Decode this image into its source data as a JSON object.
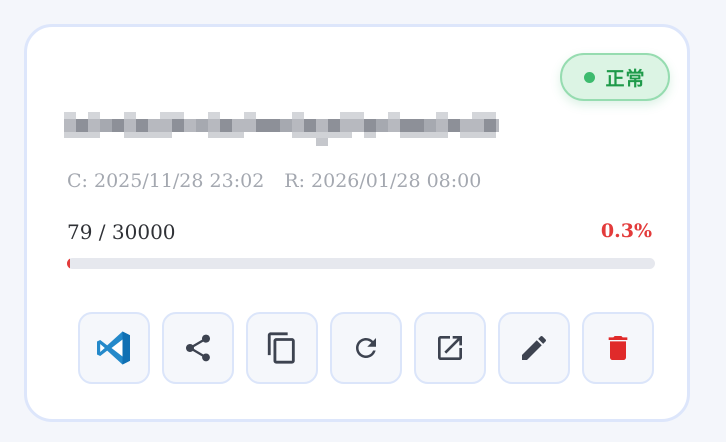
{
  "status": {
    "label": "正常",
    "color": "#1f9a4a",
    "dot_color": "#3dbb6e"
  },
  "item": {
    "name_redacted": true,
    "created": "C: 2025/11/28 23:02",
    "renews": "R: 2026/01/28 08:00"
  },
  "usage": {
    "text": "79 / 30000",
    "used": 79,
    "total": 30000,
    "percent_label": "0.3%",
    "percent": 0.3,
    "fill_color": "#e33b3b"
  },
  "actions": [
    {
      "name": "vscode-button",
      "icon": "vscode-icon",
      "color": "#1a8ad8"
    },
    {
      "name": "share-button",
      "icon": "share-icon",
      "color": "#3d4350"
    },
    {
      "name": "copy-button",
      "icon": "copy-icon",
      "color": "#3d4350"
    },
    {
      "name": "refresh-button",
      "icon": "refresh-icon",
      "color": "#3d4350"
    },
    {
      "name": "open-external-button",
      "icon": "open-external-icon",
      "color": "#3d4350"
    },
    {
      "name": "edit-button",
      "icon": "pencil-icon",
      "color": "#3d4350"
    },
    {
      "name": "delete-button",
      "icon": "trash-icon",
      "color": "#e02a2a"
    }
  ]
}
